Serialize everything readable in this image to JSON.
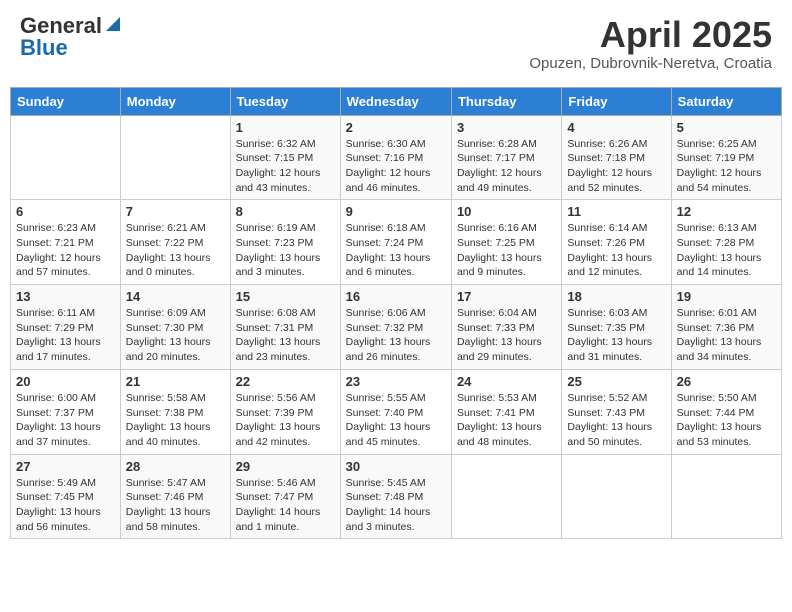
{
  "header": {
    "logo_general": "General",
    "logo_blue": "Blue",
    "month": "April 2025",
    "location": "Opuzen, Dubrovnik-Neretva, Croatia"
  },
  "weekdays": [
    "Sunday",
    "Monday",
    "Tuesday",
    "Wednesday",
    "Thursday",
    "Friday",
    "Saturday"
  ],
  "weeks": [
    [
      {
        "day": "",
        "info": ""
      },
      {
        "day": "",
        "info": ""
      },
      {
        "day": "1",
        "info": "Sunrise: 6:32 AM\nSunset: 7:15 PM\nDaylight: 12 hours and 43 minutes."
      },
      {
        "day": "2",
        "info": "Sunrise: 6:30 AM\nSunset: 7:16 PM\nDaylight: 12 hours and 46 minutes."
      },
      {
        "day": "3",
        "info": "Sunrise: 6:28 AM\nSunset: 7:17 PM\nDaylight: 12 hours and 49 minutes."
      },
      {
        "day": "4",
        "info": "Sunrise: 6:26 AM\nSunset: 7:18 PM\nDaylight: 12 hours and 52 minutes."
      },
      {
        "day": "5",
        "info": "Sunrise: 6:25 AM\nSunset: 7:19 PM\nDaylight: 12 hours and 54 minutes."
      }
    ],
    [
      {
        "day": "6",
        "info": "Sunrise: 6:23 AM\nSunset: 7:21 PM\nDaylight: 12 hours and 57 minutes."
      },
      {
        "day": "7",
        "info": "Sunrise: 6:21 AM\nSunset: 7:22 PM\nDaylight: 13 hours and 0 minutes."
      },
      {
        "day": "8",
        "info": "Sunrise: 6:19 AM\nSunset: 7:23 PM\nDaylight: 13 hours and 3 minutes."
      },
      {
        "day": "9",
        "info": "Sunrise: 6:18 AM\nSunset: 7:24 PM\nDaylight: 13 hours and 6 minutes."
      },
      {
        "day": "10",
        "info": "Sunrise: 6:16 AM\nSunset: 7:25 PM\nDaylight: 13 hours and 9 minutes."
      },
      {
        "day": "11",
        "info": "Sunrise: 6:14 AM\nSunset: 7:26 PM\nDaylight: 13 hours and 12 minutes."
      },
      {
        "day": "12",
        "info": "Sunrise: 6:13 AM\nSunset: 7:28 PM\nDaylight: 13 hours and 14 minutes."
      }
    ],
    [
      {
        "day": "13",
        "info": "Sunrise: 6:11 AM\nSunset: 7:29 PM\nDaylight: 13 hours and 17 minutes."
      },
      {
        "day": "14",
        "info": "Sunrise: 6:09 AM\nSunset: 7:30 PM\nDaylight: 13 hours and 20 minutes."
      },
      {
        "day": "15",
        "info": "Sunrise: 6:08 AM\nSunset: 7:31 PM\nDaylight: 13 hours and 23 minutes."
      },
      {
        "day": "16",
        "info": "Sunrise: 6:06 AM\nSunset: 7:32 PM\nDaylight: 13 hours and 26 minutes."
      },
      {
        "day": "17",
        "info": "Sunrise: 6:04 AM\nSunset: 7:33 PM\nDaylight: 13 hours and 29 minutes."
      },
      {
        "day": "18",
        "info": "Sunrise: 6:03 AM\nSunset: 7:35 PM\nDaylight: 13 hours and 31 minutes."
      },
      {
        "day": "19",
        "info": "Sunrise: 6:01 AM\nSunset: 7:36 PM\nDaylight: 13 hours and 34 minutes."
      }
    ],
    [
      {
        "day": "20",
        "info": "Sunrise: 6:00 AM\nSunset: 7:37 PM\nDaylight: 13 hours and 37 minutes."
      },
      {
        "day": "21",
        "info": "Sunrise: 5:58 AM\nSunset: 7:38 PM\nDaylight: 13 hours and 40 minutes."
      },
      {
        "day": "22",
        "info": "Sunrise: 5:56 AM\nSunset: 7:39 PM\nDaylight: 13 hours and 42 minutes."
      },
      {
        "day": "23",
        "info": "Sunrise: 5:55 AM\nSunset: 7:40 PM\nDaylight: 13 hours and 45 minutes."
      },
      {
        "day": "24",
        "info": "Sunrise: 5:53 AM\nSunset: 7:41 PM\nDaylight: 13 hours and 48 minutes."
      },
      {
        "day": "25",
        "info": "Sunrise: 5:52 AM\nSunset: 7:43 PM\nDaylight: 13 hours and 50 minutes."
      },
      {
        "day": "26",
        "info": "Sunrise: 5:50 AM\nSunset: 7:44 PM\nDaylight: 13 hours and 53 minutes."
      }
    ],
    [
      {
        "day": "27",
        "info": "Sunrise: 5:49 AM\nSunset: 7:45 PM\nDaylight: 13 hours and 56 minutes."
      },
      {
        "day": "28",
        "info": "Sunrise: 5:47 AM\nSunset: 7:46 PM\nDaylight: 13 hours and 58 minutes."
      },
      {
        "day": "29",
        "info": "Sunrise: 5:46 AM\nSunset: 7:47 PM\nDaylight: 14 hours and 1 minute."
      },
      {
        "day": "30",
        "info": "Sunrise: 5:45 AM\nSunset: 7:48 PM\nDaylight: 14 hours and 3 minutes."
      },
      {
        "day": "",
        "info": ""
      },
      {
        "day": "",
        "info": ""
      },
      {
        "day": "",
        "info": ""
      }
    ]
  ]
}
